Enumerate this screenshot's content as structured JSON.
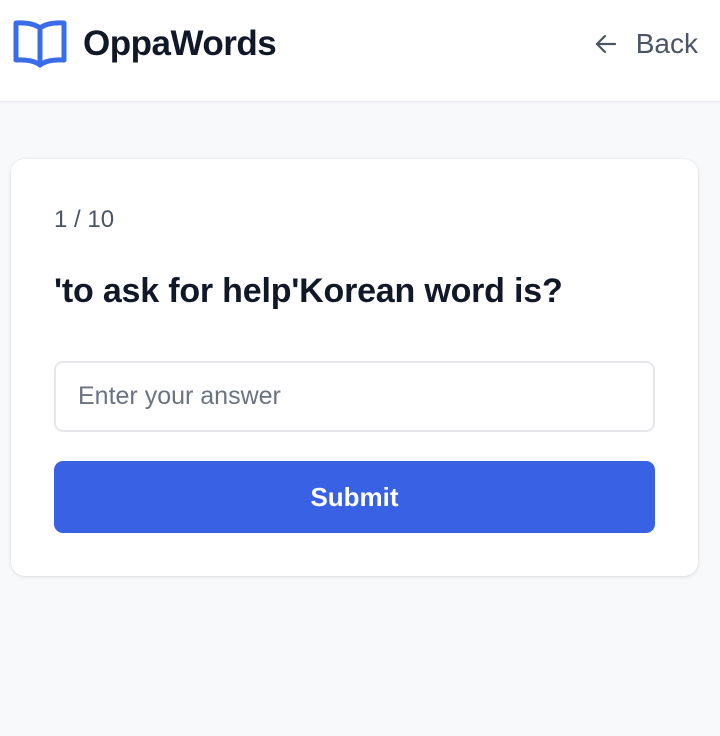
{
  "header": {
    "app_name": "OppaWords",
    "logo_icon": "open-book-icon",
    "back_label": "Back",
    "back_icon": "arrow-left-icon"
  },
  "quiz": {
    "progress": "1 / 10",
    "question": "'to ask for help'Korean word is?",
    "answer_value": "",
    "answer_placeholder": "Enter your answer",
    "submit_label": "Submit"
  },
  "colors": {
    "accent": "#3861e3",
    "logo": "#3b6ce8",
    "page_background": "#f8f9fb",
    "card_background": "#ffffff"
  }
}
